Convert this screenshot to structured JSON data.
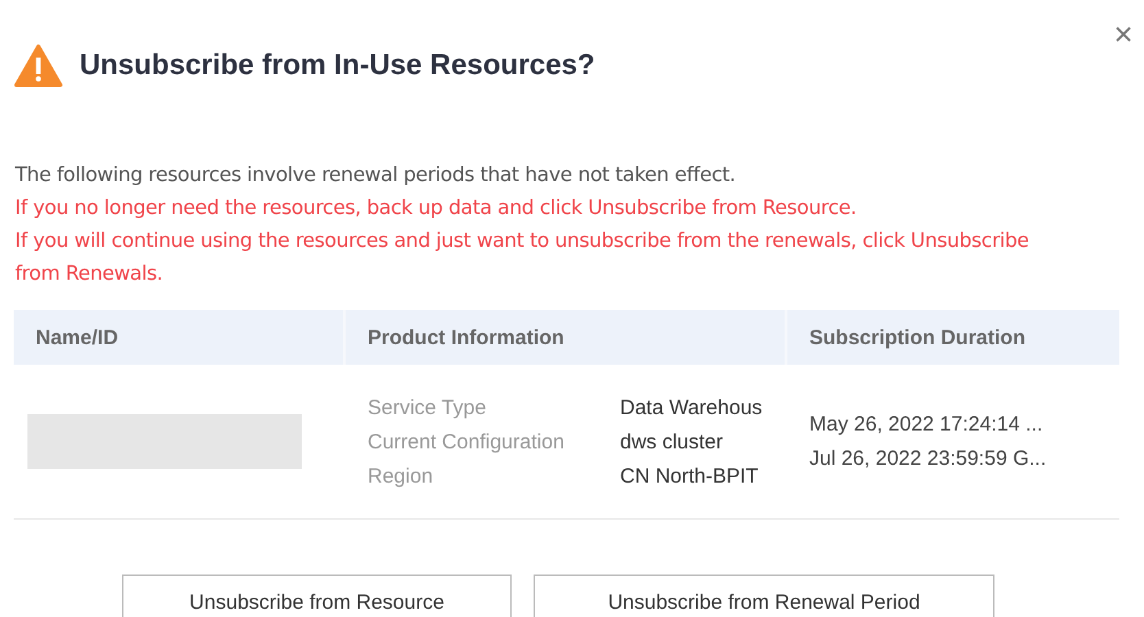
{
  "dialog": {
    "title": "Unsubscribe from In-Use Resources?",
    "close": "×"
  },
  "message": {
    "intro": "The following resources involve renewal periods that have not taken effect.",
    "warnings": [
      "If you no longer need the resources, back up data and click Unsubscribe from Resource.",
      "If you will continue using the resources and just want to unsubscribe from the renewals, click Unsubscribe from Renewals."
    ]
  },
  "table": {
    "columns": [
      "Name/ID",
      "Product Information",
      "Subscription Duration"
    ],
    "rows": [
      {
        "name_redacted": true,
        "info": [
          {
            "label": "Service Type",
            "value": "Data Warehous"
          },
          {
            "label": "Current Configuration",
            "value": "dws cluster"
          },
          {
            "label": "Region",
            "value": "CN North-BPIT"
          }
        ],
        "duration": [
          "May 26, 2022 17:24:14 ...",
          "Jul 26, 2022 23:59:59 G..."
        ]
      }
    ]
  },
  "buttons": [
    "Unsubscribe from Resource",
    "Unsubscribe from Renewal Period"
  ]
}
